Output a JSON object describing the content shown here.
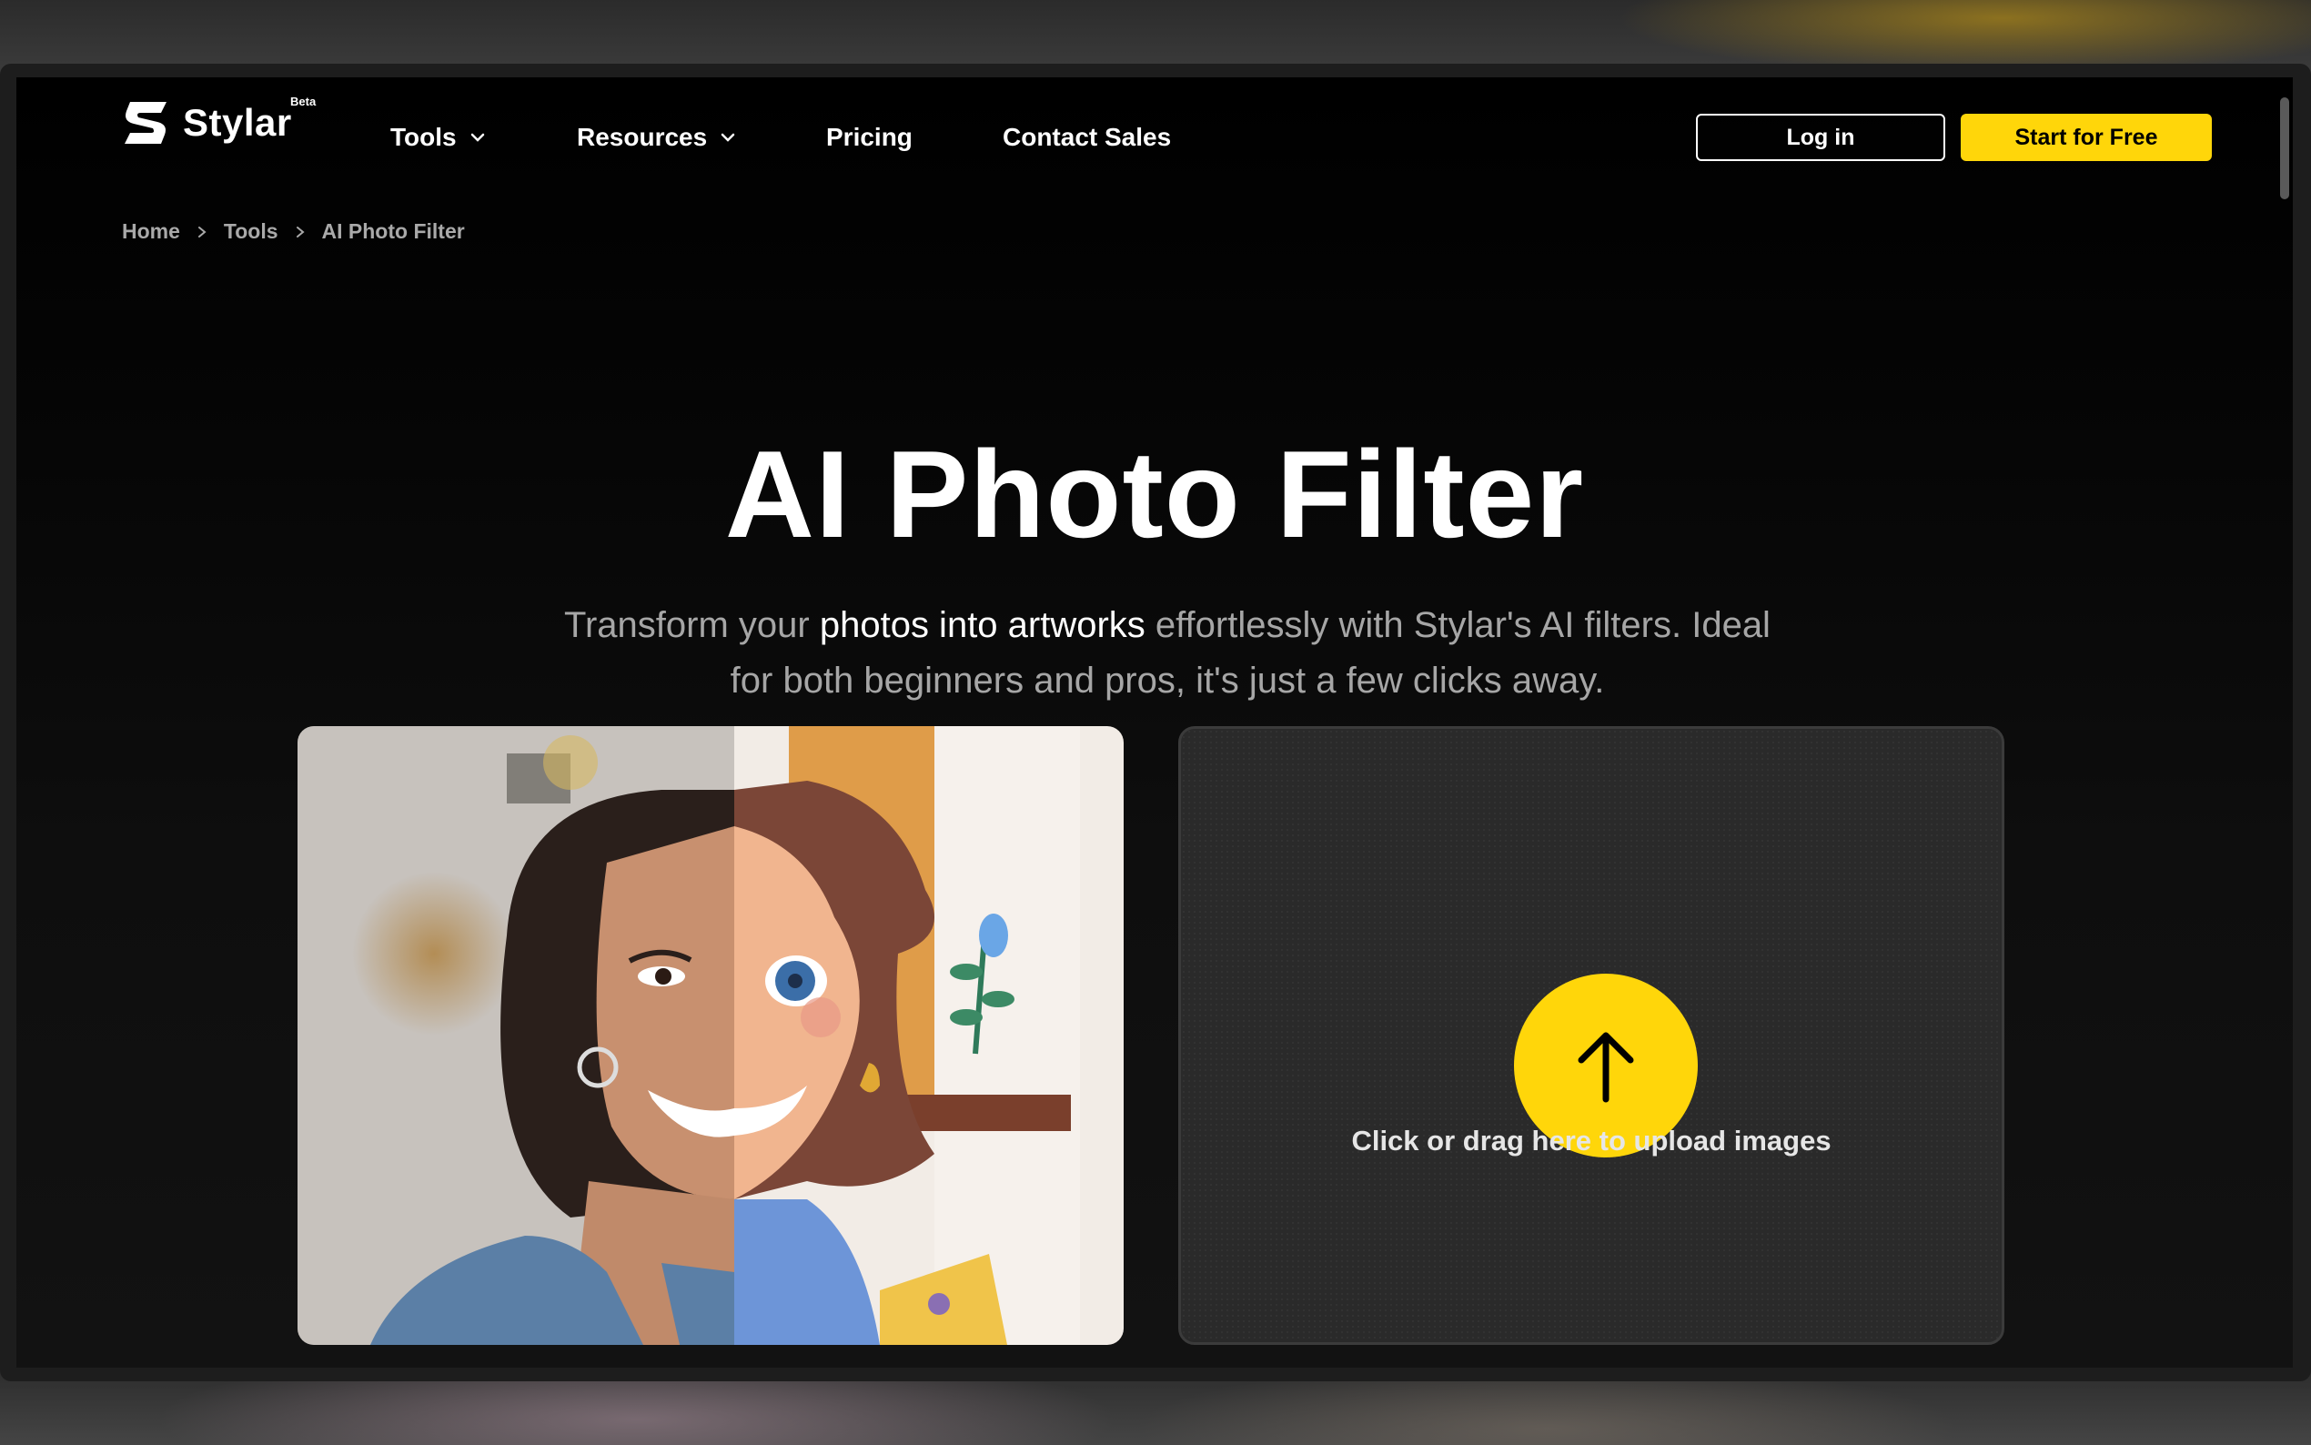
{
  "nav": {
    "brand": "Stylar",
    "brand_badge": "Beta",
    "items": [
      {
        "label": "Tools",
        "has_dropdown": true
      },
      {
        "label": "Resources",
        "has_dropdown": true
      },
      {
        "label": "Pricing",
        "has_dropdown": false
      },
      {
        "label": "Contact Sales",
        "has_dropdown": false
      }
    ],
    "login_label": "Log in",
    "start_label": "Start for Free"
  },
  "breadcrumb": [
    "Home",
    "Tools",
    "AI Photo Filter"
  ],
  "hero": {
    "title": "AI Photo Filter",
    "subtitle_pre": "Transform your ",
    "subtitle_highlight": "photos into artworks",
    "subtitle_post": " effortlessly with Stylar's AI filters. Ideal for both beginners and pros, it's just a few clicks away."
  },
  "upload": {
    "label": "Click or drag here to upload images",
    "icon": "arrow-up-icon"
  },
  "colors": {
    "accent": "#ffd60a",
    "background": "#000000",
    "text": "#ffffff",
    "muted": "#a6a6a6"
  }
}
